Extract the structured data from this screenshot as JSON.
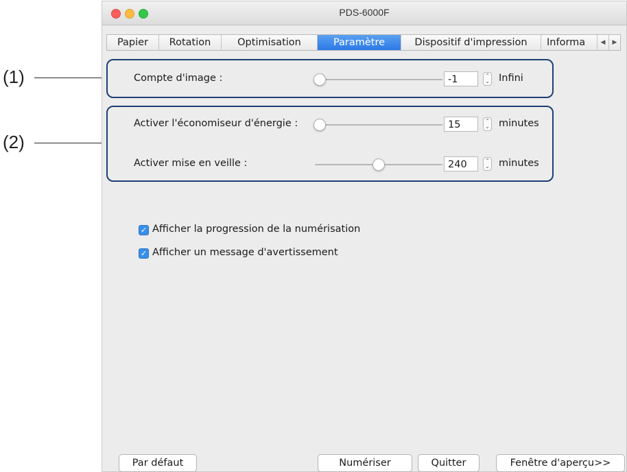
{
  "callouts": {
    "one": "(1)",
    "two": "(2)"
  },
  "window": {
    "title": "PDS-6000F"
  },
  "tabs": [
    {
      "label": "Papier"
    },
    {
      "label": "Rotation"
    },
    {
      "label": "Optimisation"
    },
    {
      "label": "Paramètre",
      "active": true
    },
    {
      "label": "Dispositif d'impression"
    },
    {
      "label": "Informa"
    }
  ],
  "tab_scroll": {
    "left_icon": "arrow-left-icon",
    "right_icon": "arrow-right-icon"
  },
  "image_count": {
    "label": "Compte d'image :",
    "value": "-1",
    "unit": "Infini",
    "slider_fraction": 0.04
  },
  "energy_saver": {
    "label": "Activer l'économiseur d'énergie :",
    "value": "15",
    "unit": "minutes",
    "slider_fraction": 0.04
  },
  "sleep": {
    "label": "Activer mise en veille :",
    "value": "240",
    "unit": "minutes",
    "slider_fraction": 0.5
  },
  "options": [
    {
      "label": "Afficher la progression de la numérisation",
      "checked": true
    },
    {
      "label": "Afficher un message d'avertissement",
      "checked": true
    }
  ],
  "buttons": {
    "default": "Par défaut",
    "scan": "Numériser",
    "quit": "Quitter",
    "preview": "Fenêtre d'aperçu>>"
  },
  "colors": {
    "accent": "#2c79e6",
    "group_border": "#1c3f73",
    "checkbox": "#3a8fe8"
  }
}
